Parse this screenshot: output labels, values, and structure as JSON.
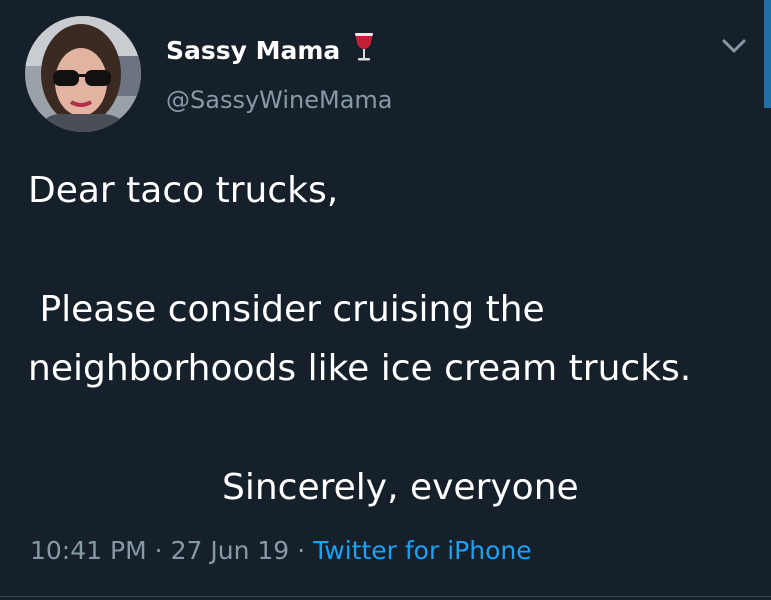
{
  "user": {
    "display_name": "Sassy Mama",
    "name_emoji": "🍷",
    "handle": "@SassyWineMama",
    "avatar": "avatar-photo"
  },
  "tweet": {
    "line1": "Dear taco trucks,",
    "line2": " Please consider cruising the",
    "line3": "neighborhoods like ice cream trucks.",
    "line4": "Sincerely, everyone"
  },
  "meta": {
    "time": "10:41 PM",
    "separator": "·",
    "date": "27 Jun 19",
    "source": "Twitter for iPhone"
  },
  "icons": {
    "menu": "chevron-down-icon",
    "emoji": "wine-glass-icon"
  },
  "colors": {
    "background": "#15202b",
    "text": "#ffffff",
    "secondary": "#8899a6",
    "link": "#1da1f2"
  }
}
